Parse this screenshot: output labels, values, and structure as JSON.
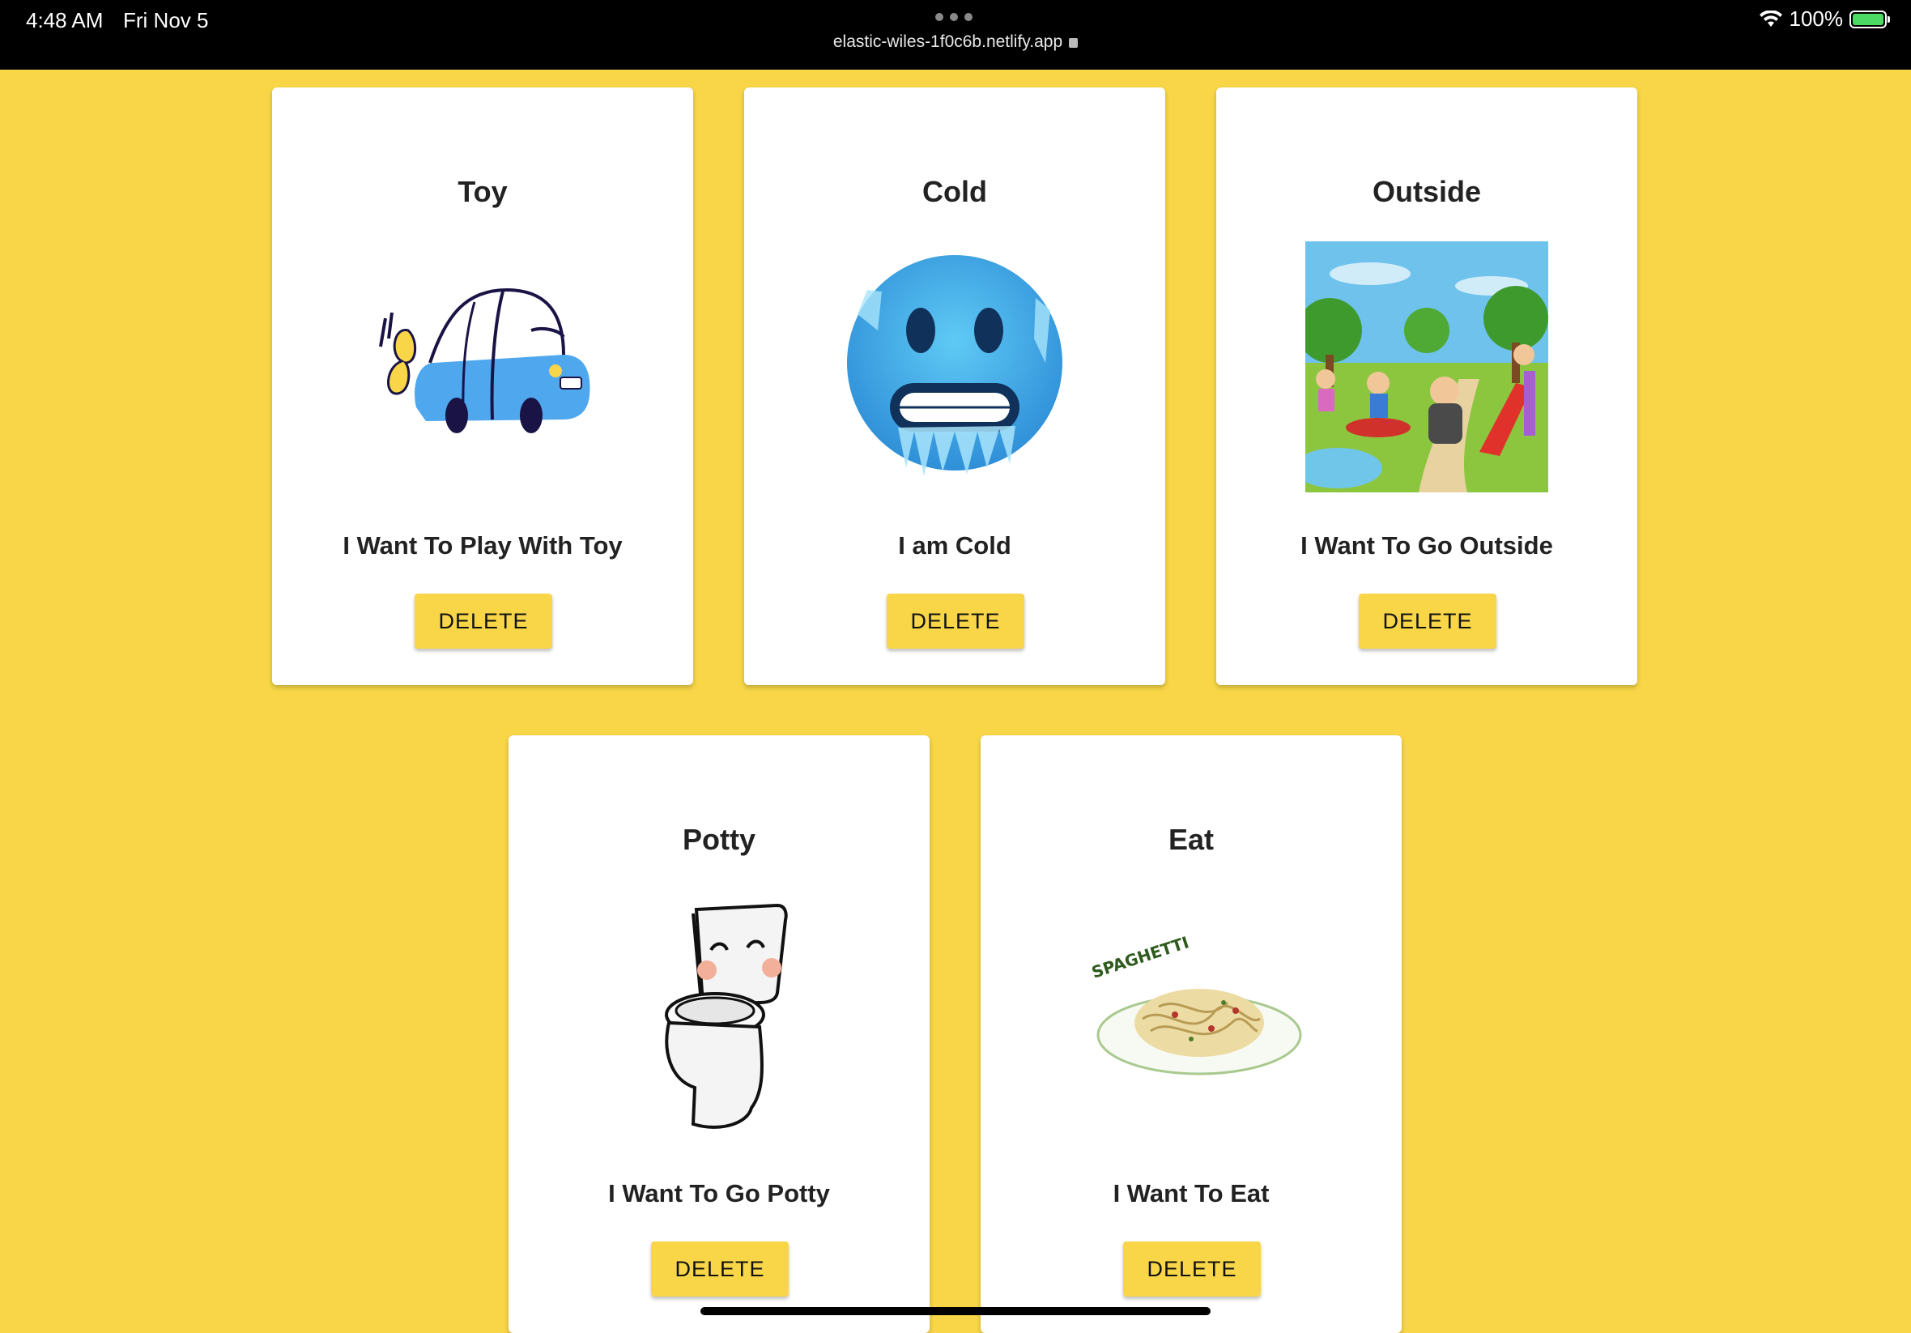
{
  "status_bar": {
    "time": "4:48 AM",
    "date": "Fri Nov 5",
    "url": "elastic-wiles-1f0c6b.netlify.app",
    "battery": "100%"
  },
  "cards": [
    {
      "title": "Toy",
      "phrase": "I Want To Play With Toy",
      "delete_label": "DELETE",
      "image": "toy-car-illustration"
    },
    {
      "title": "Cold",
      "phrase": "I am Cold",
      "delete_label": "DELETE",
      "image": "cold-face-emoji"
    },
    {
      "title": "Outside",
      "phrase": "I Want To Go Outside",
      "delete_label": "DELETE",
      "image": "playground-illustration"
    },
    {
      "title": "Potty",
      "phrase": "I Want To Go Potty",
      "delete_label": "DELETE",
      "image": "toilet-illustration"
    },
    {
      "title": "Eat",
      "phrase": "I Want To Eat",
      "delete_label": "DELETE",
      "image": "spaghetti-illustration",
      "image_text": "SPAGHETTI"
    }
  ],
  "colors": {
    "background": "#F8D648",
    "button": "#F8D648",
    "card": "#FFFFFF"
  }
}
